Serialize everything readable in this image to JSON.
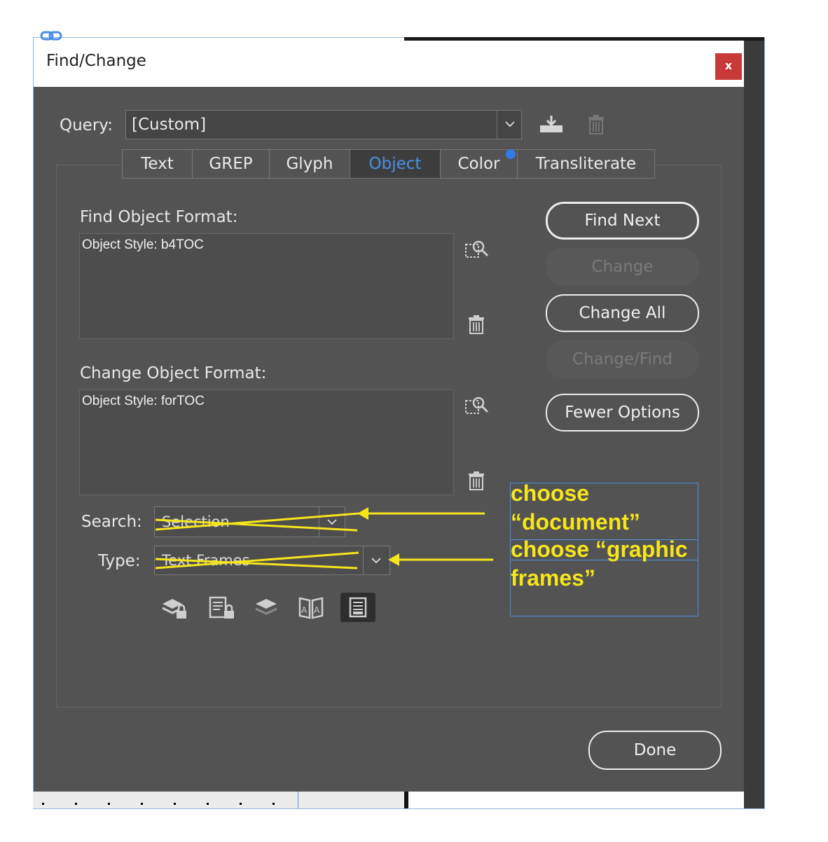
{
  "dialog": {
    "title": "Find/Change",
    "close_label": "x"
  },
  "query": {
    "label": "Query:",
    "value": "[Custom]"
  },
  "tabs": [
    {
      "label": "Text"
    },
    {
      "label": "GREP"
    },
    {
      "label": "Glyph"
    },
    {
      "label": "Object",
      "active": true
    },
    {
      "label": "Color"
    },
    {
      "label": "Transliterate"
    }
  ],
  "find_format": {
    "label": "Find Object Format:",
    "value": "Object Style: b4TOC"
  },
  "change_format": {
    "label": "Change Object Format:",
    "value": "Object Style: forTOC"
  },
  "buttons": {
    "find_next": "Find Next",
    "change": "Change",
    "change_all": "Change All",
    "change_find": "Change/Find",
    "fewer_options": "Fewer Options",
    "done": "Done"
  },
  "search": {
    "label": "Search:",
    "value": "Selection"
  },
  "type": {
    "label": "Type:",
    "value": "Text Frames"
  },
  "option_icons": [
    "lock-layers-icon",
    "lock-stories-icon",
    "hidden-layers-icon",
    "master-pages-icon",
    "footnotes-icon"
  ],
  "annotations": {
    "note1": "choose “document”",
    "note1_line1": "choose",
    "note1_line2": "“document”",
    "note2_line1": "choose “graphic",
    "note2_line2": "frames”",
    "color": "#f5e51b"
  }
}
